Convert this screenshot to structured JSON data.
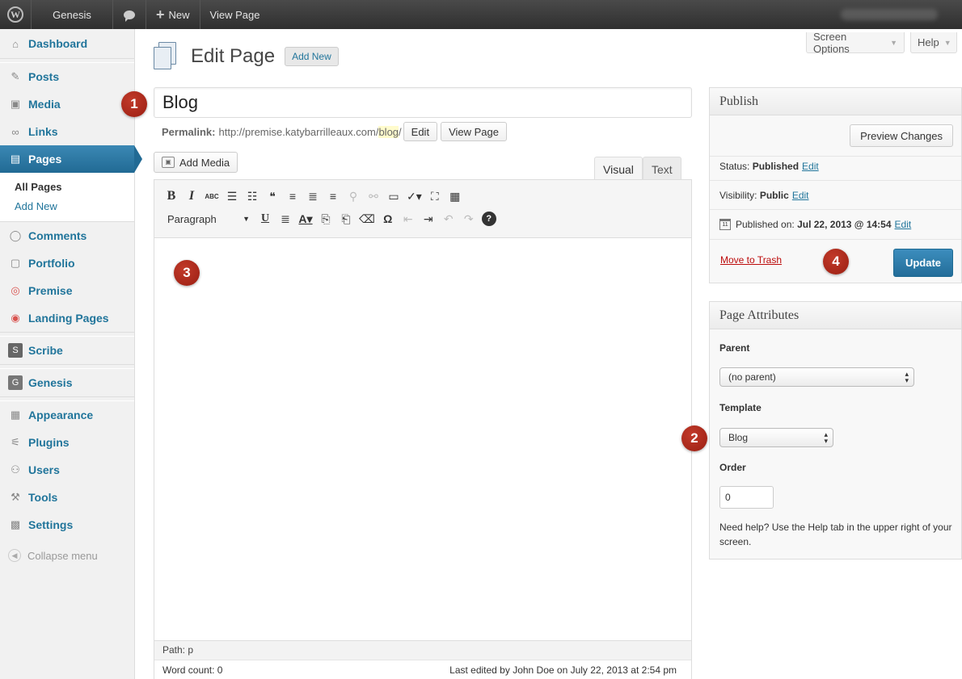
{
  "adminbar": {
    "site_name": "Genesis",
    "new_label": "New",
    "view_page_label": "View Page"
  },
  "sidebar": {
    "items": [
      {
        "label": "Dashboard",
        "icon": "home-icon"
      },
      {
        "label": "Posts",
        "icon": "pin-icon"
      },
      {
        "label": "Media",
        "icon": "media-icon"
      },
      {
        "label": "Links",
        "icon": "link-icon"
      },
      {
        "label": "Pages",
        "icon": "pages-icon"
      },
      {
        "label": "Comments",
        "icon": "comment-icon"
      },
      {
        "label": "Portfolio",
        "icon": "portfolio-icon"
      },
      {
        "label": "Premise",
        "icon": "premise-icon"
      },
      {
        "label": "Landing Pages",
        "icon": "landing-icon"
      },
      {
        "label": "Scribe",
        "icon": "scribe-icon"
      },
      {
        "label": "Genesis",
        "icon": "genesis-icon"
      },
      {
        "label": "Appearance",
        "icon": "appearance-icon"
      },
      {
        "label": "Plugins",
        "icon": "plugin-icon"
      },
      {
        "label": "Users",
        "icon": "users-icon"
      },
      {
        "label": "Tools",
        "icon": "tools-icon"
      },
      {
        "label": "Settings",
        "icon": "settings-icon"
      }
    ],
    "submenu": [
      "All Pages",
      "Add New"
    ],
    "collapse_label": "Collapse menu"
  },
  "screen_options_label": "Screen Options",
  "help_label": "Help",
  "heading": {
    "title": "Edit Page",
    "add_new": "Add New"
  },
  "post": {
    "title": "Blog",
    "permalink_label": "Permalink:",
    "permalink_base": "http://premise.katybarrilleaux.com/",
    "permalink_slug": "blog",
    "permalink_trail": "/",
    "edit_label": "Edit",
    "view_page_label": "View Page"
  },
  "editor": {
    "add_media_label": "Add Media",
    "tab_visual": "Visual",
    "tab_text": "Text",
    "format_select": "Paragraph",
    "path": "Path: p",
    "word_count": "Word count: 0",
    "last_edited": "Last edited by John Doe on July 22, 2013 at 2:54 pm"
  },
  "publish": {
    "title": "Publish",
    "preview_label": "Preview Changes",
    "status_label": "Status:",
    "status_value": "Published",
    "visibility_label": "Visibility:",
    "visibility_value": "Public",
    "published_label": "Published on:",
    "published_value": "Jul 22, 2013 @ 14:54",
    "edit_label": "Edit",
    "trash_label": "Move to Trash",
    "update_label": "Update"
  },
  "attributes": {
    "title": "Page Attributes",
    "parent_label": "Parent",
    "parent_value": "(no parent)",
    "template_label": "Template",
    "template_value": "Blog",
    "order_label": "Order",
    "order_value": "0",
    "help_text": "Need help? Use the Help tab in the upper right of your screen."
  },
  "callouts": [
    "1",
    "2",
    "3",
    "4"
  ],
  "colors": {
    "accent": "#21759b",
    "current_menu": "#216a94",
    "callout": "#a8281a",
    "trash": "#bc0b0b"
  }
}
